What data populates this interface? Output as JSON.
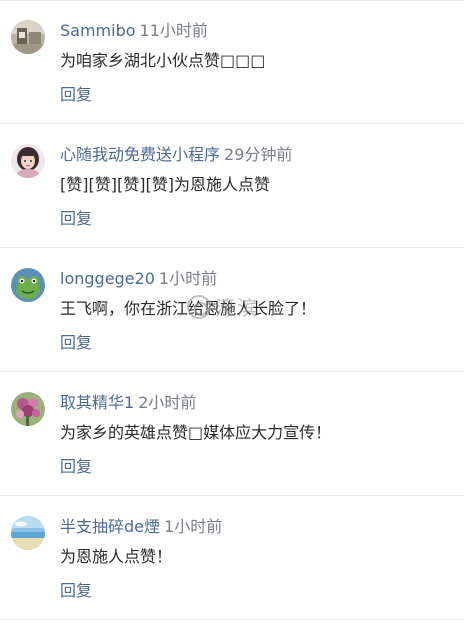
{
  "comments": [
    {
      "username": "Sammibo",
      "time": "11小时前",
      "text": "为咱家乡湖北小伙点赞□□□",
      "reply_label": "回复",
      "avatar_icon": "landscape-photo-avatar"
    },
    {
      "username": "心随我动免费送小程序",
      "time": "29分钟前",
      "text": "[赞][赞][赞][赞]为恩施人点赞",
      "reply_label": "回复",
      "avatar_icon": "portrait-girl-avatar"
    },
    {
      "username": "longgege20",
      "time": "1小时前",
      "text": "王飞啊，你在浙江给恩施人长脸了！",
      "reply_label": "回复",
      "avatar_icon": "green-frog-avatar"
    },
    {
      "username": "取其精华1",
      "time": "2小时前",
      "text": "为家乡的英雄点赞□媒体应大力宣传！",
      "reply_label": "回复",
      "avatar_icon": "flower-bouquet-avatar"
    },
    {
      "username": "半支抽碎de煙",
      "time": "1小时前",
      "text": "为恩施人点赞！",
      "reply_label": "回复",
      "avatar_icon": "beach-sky-avatar"
    }
  ],
  "watermark": {
    "text": "濠滨"
  },
  "colors": {
    "username": "#4c6a98",
    "time": "#7a7f87",
    "text": "#2b2b2b",
    "divider": "#ebebeb"
  }
}
